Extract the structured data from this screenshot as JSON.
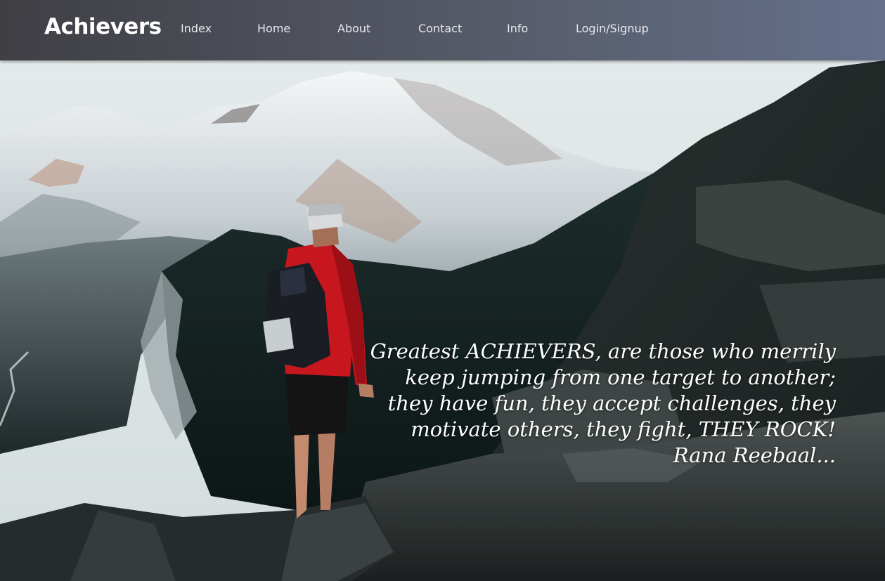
{
  "header": {
    "brand": "Achievers",
    "nav": [
      {
        "label": "Index"
      },
      {
        "label": "Home"
      },
      {
        "label": "About"
      },
      {
        "label": "Contact"
      },
      {
        "label": "Info"
      },
      {
        "label": "Login/Signup"
      }
    ]
  },
  "hero": {
    "image": "hiker-overlooking-snowy-mountain",
    "quote": "Greatest ACHIEVERS, are those who merrily keep jumping from one target to another; they have fun, they accept challenges, they motivate others, they fight, THEY ROCK!",
    "author": "Rana Reebaal..."
  },
  "colors": {
    "navbar_start": "#3f3f44",
    "navbar_end": "#65708b",
    "text": "#ffffff",
    "jacket": "#c8161e"
  }
}
